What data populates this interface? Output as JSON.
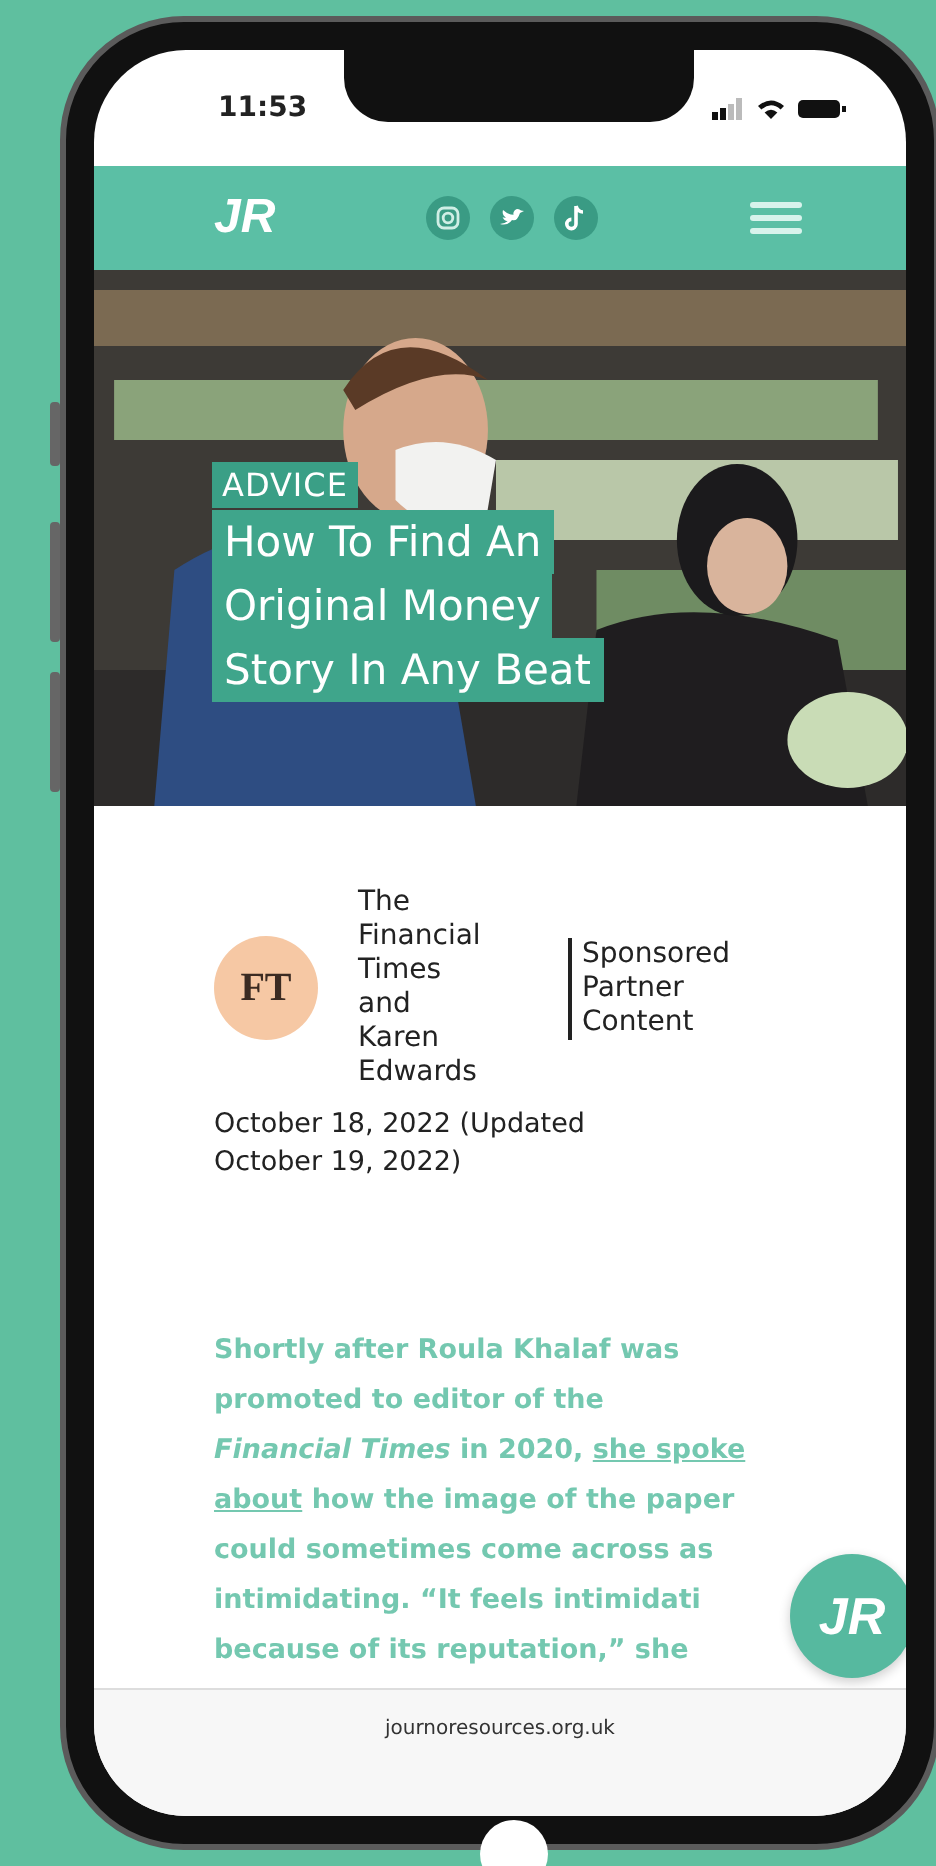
{
  "status_bar": {
    "time": "11:53"
  },
  "header": {
    "logo": "JR",
    "social_icons": [
      {
        "kind": "instagram"
      },
      {
        "kind": "twitter"
      },
      {
        "kind": "tiktok"
      }
    ]
  },
  "hero": {
    "kind": "picture",
    "tag": "ADVICE",
    "title_lines": [
      "How To Find An",
      "Original Money",
      "Story In Any Beat"
    ]
  },
  "byline": {
    "logo": "FT",
    "author_lines": [
      "The",
      "Financial",
      "Times",
      "and",
      "Karen",
      "Edwards"
    ],
    "sponsor_lines": [
      "Sponsored",
      "Partner",
      "Content"
    ]
  },
  "date_lines": [
    "October 18, 2022 (Updated",
    "October 19, 2022)"
  ],
  "article": {
    "lines": [
      [
        {
          "kind": "text",
          "text": "Shortly after Roula Khalaf was"
        }
      ],
      [
        {
          "kind": "text",
          "text": "promoted to editor of the"
        }
      ],
      [
        {
          "kind": "italic",
          "text": "Financial Times"
        },
        {
          "kind": "text",
          "text": " in 2020, "
        },
        {
          "kind": "link",
          "text": "she spoke"
        }
      ],
      [
        {
          "kind": "link",
          "text": "about"
        },
        {
          "kind": "text",
          "text": " how the image of the paper"
        }
      ],
      [
        {
          "kind": "text",
          "text": "could sometimes come across as"
        }
      ],
      [
        {
          "kind": "text",
          "text": "intimidating. “It feels intimidati"
        }
      ],
      [
        {
          "kind": "text",
          "text": "because of its reputation,” she"
        }
      ]
    ]
  },
  "fab": {
    "label": "JR"
  },
  "browser_bar": {
    "url": "journoresources.org.uk"
  }
}
